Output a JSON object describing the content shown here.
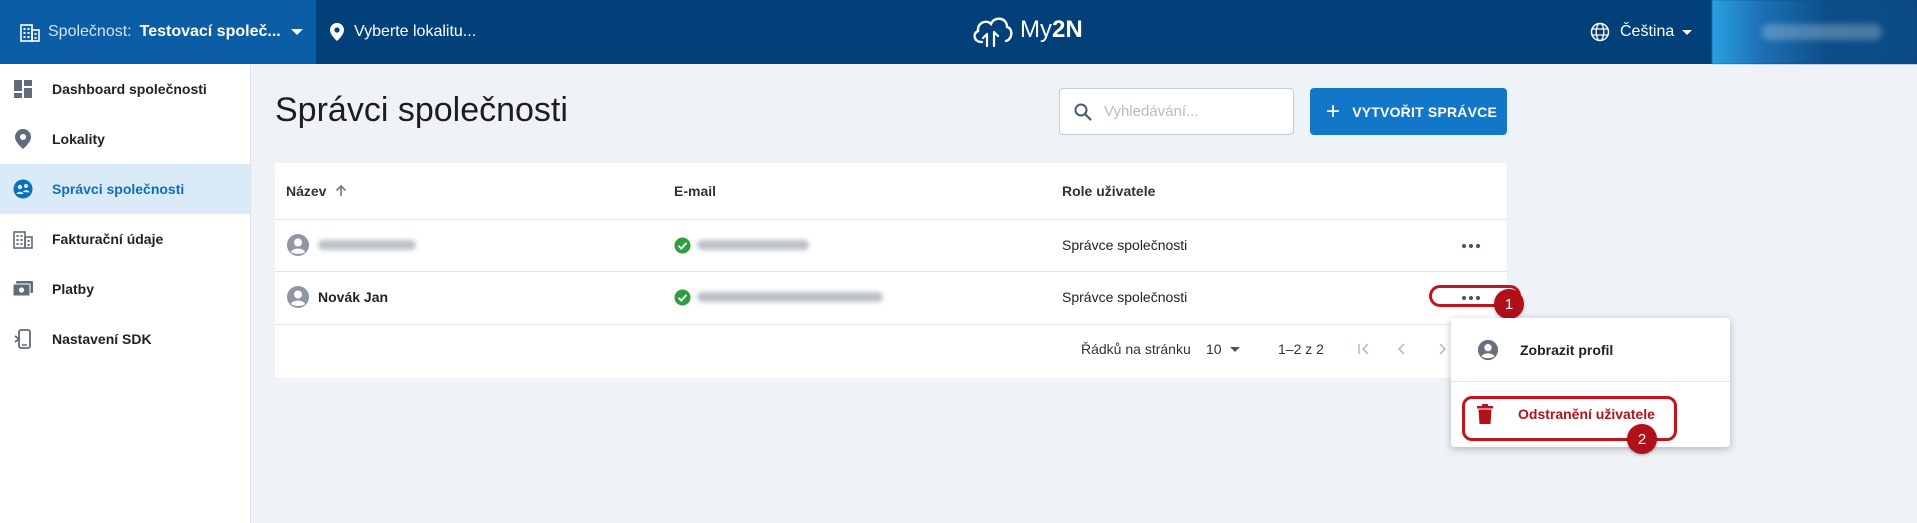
{
  "topbar": {
    "company_label": "Společnost:",
    "company_value": "Testovací společ...",
    "location_placeholder": "Vyberte lokalitu...",
    "logo_prefix": "My",
    "logo_suffix": "2N",
    "language": "Čeština"
  },
  "sidebar": {
    "items": [
      {
        "label": "Dashboard společnosti",
        "icon": "dashboard-icon"
      },
      {
        "label": "Lokality",
        "icon": "location-icon"
      },
      {
        "label": "Správci společnosti",
        "icon": "admins-icon",
        "active": true
      },
      {
        "label": "Fakturační údaje",
        "icon": "billing-icon"
      },
      {
        "label": "Platby",
        "icon": "payments-icon"
      },
      {
        "label": "Nastavení SDK",
        "icon": "sdk-icon"
      }
    ]
  },
  "main": {
    "title": "Správci společnosti",
    "search_placeholder": "Vyhledávání...",
    "create_button": "VYTVOŘIT SPRÁVCE"
  },
  "table": {
    "columns": [
      "Název",
      "E-mail",
      "Role uživatele"
    ],
    "rows": [
      {
        "name": "",
        "name_blurred": true,
        "email_verified": true,
        "role": "Správce společnosti"
      },
      {
        "name": "Novák Jan",
        "name_blurred": false,
        "email_verified": true,
        "role": "Správce společnosti"
      }
    ],
    "pagination": {
      "rows_per_page_label": "Řádků na stránku",
      "rows_per_page": "10",
      "range": "1–2 z 2"
    }
  },
  "menu": {
    "items": [
      {
        "label": "Zobrazit profil",
        "icon": "profile-icon"
      },
      {
        "label": "Odstranění uživatele",
        "icon": "trash-icon"
      }
    ]
  },
  "annotations": {
    "badge_1": "1",
    "badge_2": "2"
  },
  "colors": {
    "topbar": "#02407a",
    "company": "#0b5ea5",
    "accent": "#1277c9",
    "danger": "#c1151d",
    "verified": "#2e9c3f"
  }
}
